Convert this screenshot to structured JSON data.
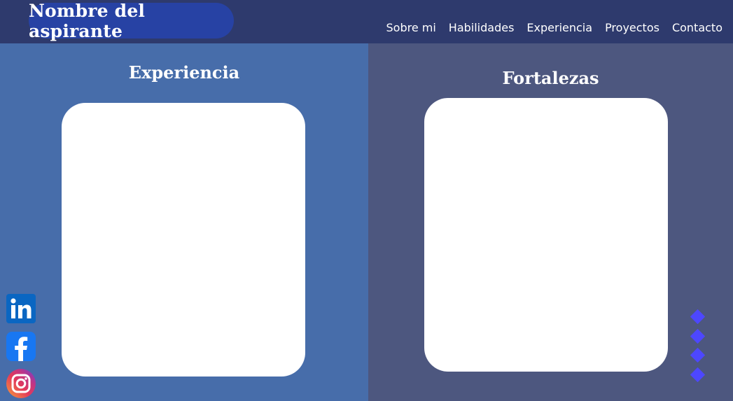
{
  "header": {
    "brand": "Nombre del aspirante",
    "nav": [
      "Sobre mi",
      "Habilidades",
      "Experiencia",
      "Proyectos",
      "Contacto"
    ]
  },
  "sections": {
    "left": {
      "title": "Experiencia"
    },
    "right": {
      "title": "Fortalezas"
    }
  },
  "social": [
    {
      "name": "linkedin",
      "icon": "linkedin-icon"
    },
    {
      "name": "facebook",
      "icon": "facebook-icon"
    },
    {
      "name": "instagram",
      "icon": "instagram-icon"
    }
  ],
  "slider_dots": 4,
  "colors": {
    "header": "#2e3a6d",
    "brand_bg": "#2742a4",
    "left_panel": "#476daa",
    "right_panel": "#4d577f",
    "dot": "#4d47ff"
  }
}
